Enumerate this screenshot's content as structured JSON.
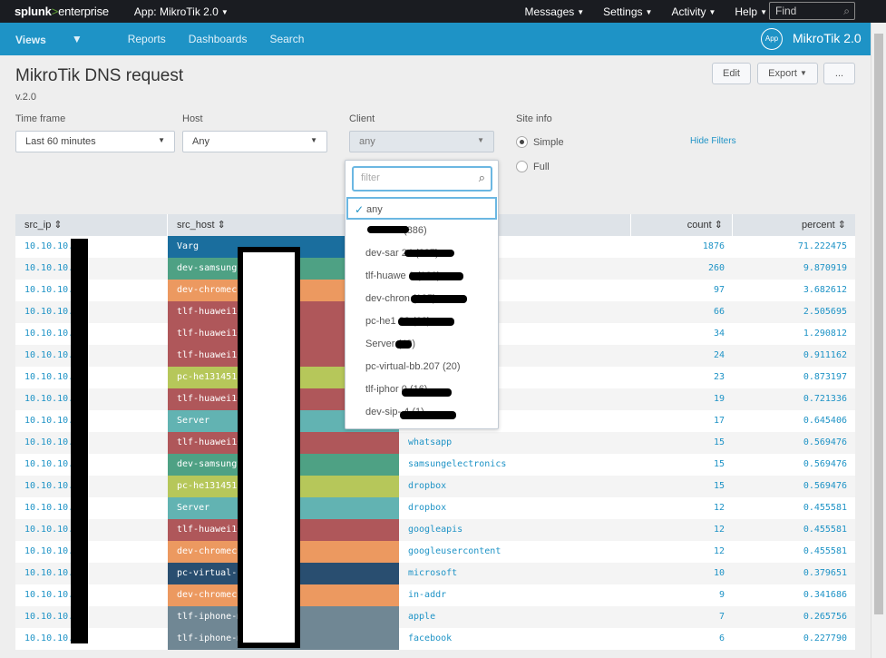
{
  "topbar": {
    "logo_main": "splunk",
    "logo_gt": ">",
    "logo_ent": "enterprise",
    "app_menu": "App: MikroTik 2.0",
    "nav": [
      "Messages",
      "Settings",
      "Activity",
      "Help"
    ],
    "find_placeholder": "Find"
  },
  "appbar": {
    "nav": [
      "Views",
      "Reports",
      "Dashboards",
      "Search"
    ],
    "badge": "App",
    "app_title": "MikroTik 2.0"
  },
  "dashboard": {
    "title": "MikroTik DNS request",
    "version": "v.2.0",
    "buttons": {
      "edit": "Edit",
      "export": "Export",
      "more": "..."
    },
    "filters": {
      "timeframe_label": "Time frame",
      "timeframe_value": "Last 60 minutes",
      "host_label": "Host",
      "host_value": "Any",
      "client_label": "Client",
      "client_value": "any",
      "siteinfo_label": "Site info",
      "siteinfo_options": [
        "Simple",
        "Full"
      ],
      "siteinfo_selected": "Simple",
      "hide_filters": "Hide Filters"
    }
  },
  "dropdown": {
    "filter_placeholder": "filter",
    "options": [
      "any",
      "(886)",
      "dev-sar 24 (287)",
      "tlf-huawe 1 (189)",
      "dev-chron (125)",
      "pc-he1 28 (62)",
      "Server (48)",
      "pc-virtual-bb.207 (20)",
      "tlf-iphor 0 (16)",
      "dev-sip- 4 (1)"
    ],
    "selected": "any"
  },
  "table": {
    "columns": [
      "src_ip",
      "src_host",
      "",
      "count",
      "percent"
    ],
    "rows": [
      {
        "ip": "10.10.10.",
        "host": "Varg",
        "color": "#1a6e9e",
        "domain": "",
        "count": "1876",
        "pct": "71.222475"
      },
      {
        "ip": "10.10.10.",
        "host": "dev-samsungt",
        "color": "#4ea184",
        "domain": "on",
        "count": "260",
        "pct": "9.870919"
      },
      {
        "ip": "10.10.10.",
        "host": "dev-chromeca",
        "color": "#ec9960",
        "domain": "",
        "count": "97",
        "pct": "3.682612"
      },
      {
        "ip": "10.10.10.",
        "host": "tlf-huawei10",
        "color": "#af575a",
        "domain": "",
        "count": "66",
        "pct": "2.505695"
      },
      {
        "ip": "10.10.10.",
        "host": "tlf-huawei10",
        "color": "#af575a",
        "domain": "",
        "count": "34",
        "pct": "1.290812"
      },
      {
        "ip": "10.10.10.",
        "host": "tlf-huawei10",
        "color": "#af575a",
        "domain": "",
        "count": "24",
        "pct": "0.911162"
      },
      {
        "ip": "10.10.10.",
        "host": "pc-he131451-",
        "color": "#b6c75a",
        "domain": "",
        "count": "23",
        "pct": "0.873197"
      },
      {
        "ip": "10.10.10.",
        "host": "tlf-huawei10",
        "color": "#af575a",
        "domain": "",
        "count": "19",
        "pct": "0.721336"
      },
      {
        "ip": "10.10.10.",
        "host": "Server",
        "color": "#62b3b2",
        "domain": "",
        "count": "17",
        "pct": "0.645406"
      },
      {
        "ip": "10.10.10.",
        "host": "tlf-huawei10",
        "color": "#af575a",
        "domain": "whatsapp",
        "count": "15",
        "pct": "0.569476"
      },
      {
        "ip": "10.10.10.",
        "host": "dev-samsungt",
        "color": "#4ea184",
        "domain": "samsungelectronics",
        "count": "15",
        "pct": "0.569476"
      },
      {
        "ip": "10.10.10.",
        "host": "pc-he131451-",
        "color": "#b6c75a",
        "domain": "dropbox",
        "count": "15",
        "pct": "0.569476"
      },
      {
        "ip": "10.10.10.",
        "host": "Server",
        "color": "#62b3b2",
        "domain": "dropbox",
        "count": "12",
        "pct": "0.455581"
      },
      {
        "ip": "10.10.10.",
        "host": "tlf-huawei10",
        "color": "#af575a",
        "domain": "googleapis",
        "count": "12",
        "pct": "0.455581"
      },
      {
        "ip": "10.10.10.",
        "host": "dev-chromeca",
        "color": "#ec9960",
        "domain": "googleusercontent",
        "count": "12",
        "pct": "0.455581"
      },
      {
        "ip": "10.10.10.",
        "host": "pc-virtual-b",
        "color": "#294e70",
        "domain": "microsoft",
        "count": "10",
        "pct": "0.379651"
      },
      {
        "ip": "10.10.10.",
        "host": "dev-chromeca",
        "color": "#ec9960",
        "domain": "in-addr",
        "count": "9",
        "pct": "0.341686"
      },
      {
        "ip": "10.10.10.",
        "host": "tlf-iphone-m",
        "color": "#708794",
        "domain": "apple",
        "count": "7",
        "pct": "0.265756"
      },
      {
        "ip": "10.10.10.",
        "host": "tlf-iphone-m",
        "color": "#708794",
        "domain": "facebook",
        "count": "6",
        "pct": "0.227790"
      }
    ]
  }
}
